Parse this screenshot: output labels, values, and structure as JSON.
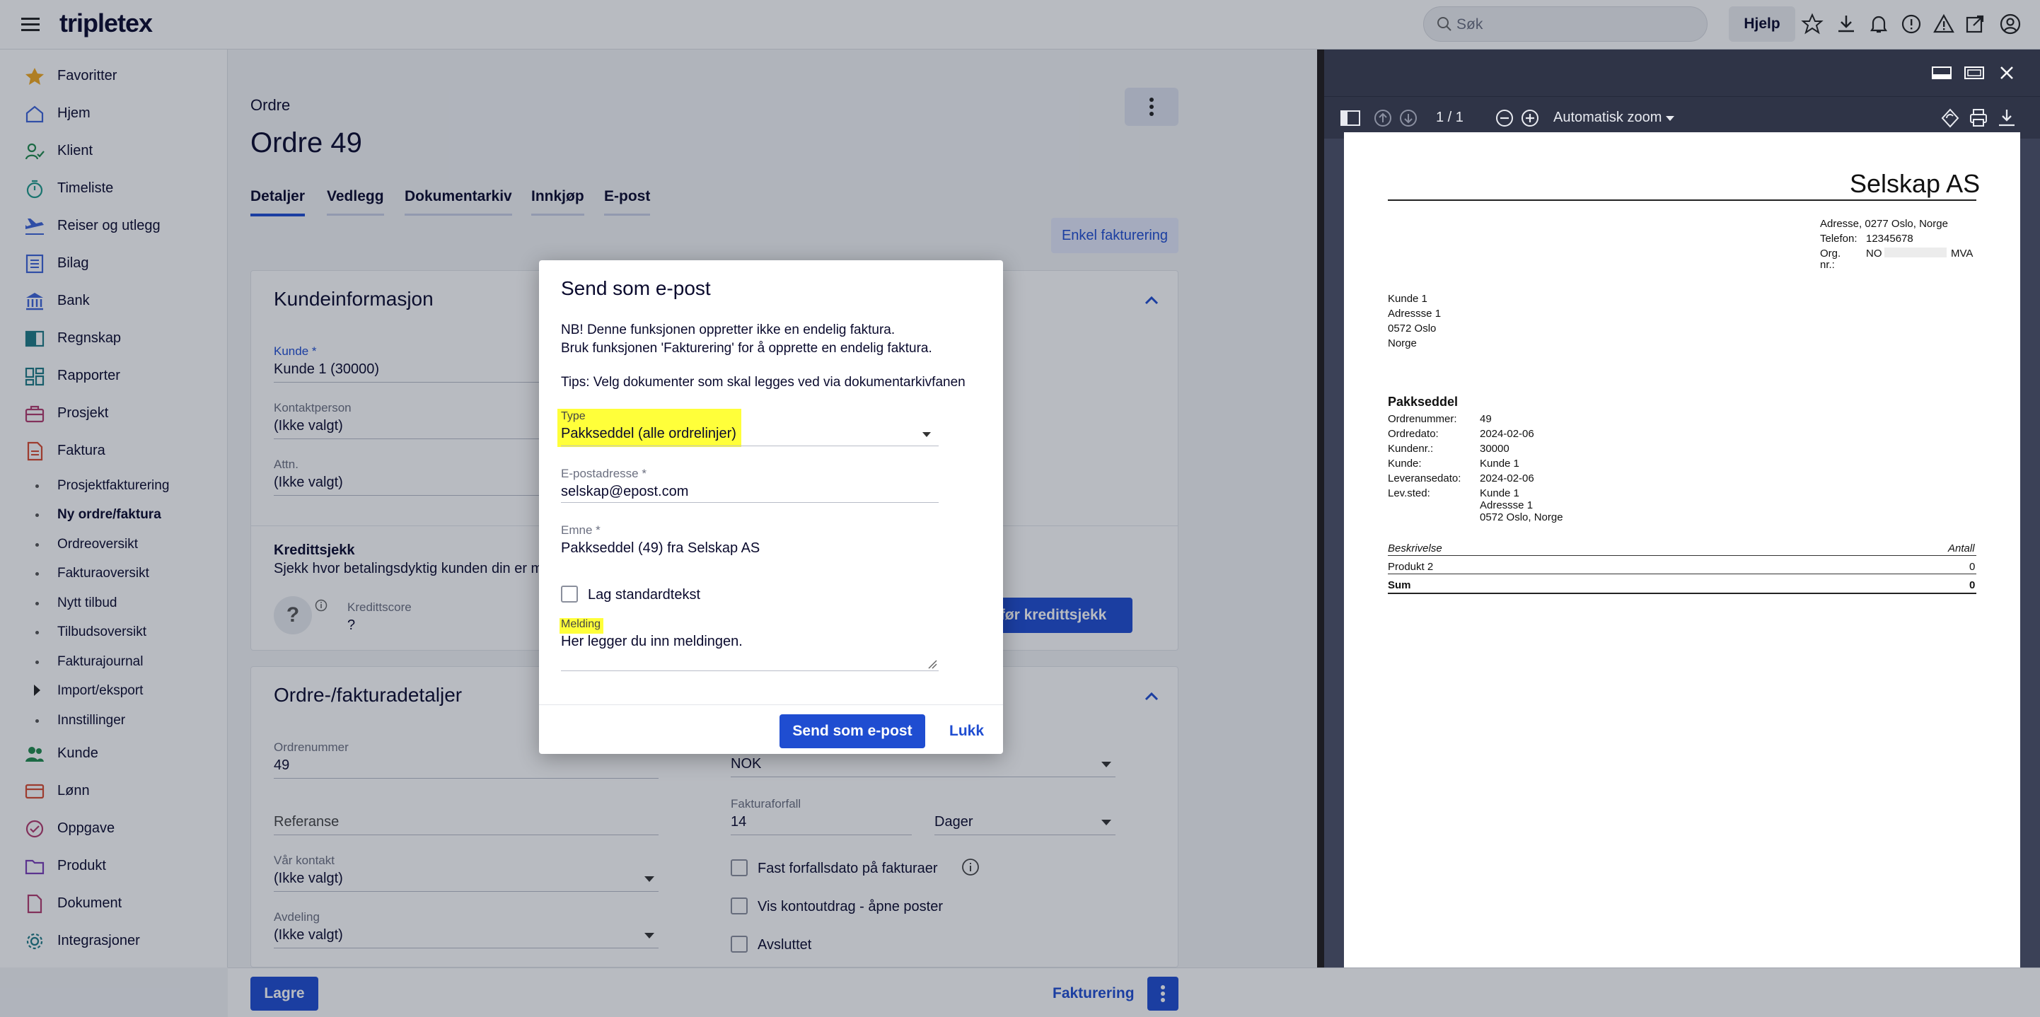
{
  "app": {
    "logo": "tripletex"
  },
  "topbar": {
    "search_placeholder": "Søk",
    "help_label": "Hjelp"
  },
  "sidebar": {
    "items": [
      {
        "label": "Favoritter",
        "icon": "star-icon"
      },
      {
        "label": "Hjem",
        "icon": "home-icon"
      },
      {
        "label": "Klient",
        "icon": "client-icon"
      },
      {
        "label": "Timeliste",
        "icon": "timer-icon"
      },
      {
        "label": "Reiser og utlegg",
        "icon": "plane-icon"
      },
      {
        "label": "Bilag",
        "icon": "document-list-icon"
      },
      {
        "label": "Bank",
        "icon": "bank-icon"
      },
      {
        "label": "Regnskap",
        "icon": "book-icon"
      },
      {
        "label": "Rapporter",
        "icon": "dashboard-icon"
      },
      {
        "label": "Prosjekt",
        "icon": "briefcase-icon"
      },
      {
        "label": "Faktura",
        "icon": "invoice-icon"
      }
    ],
    "subitems": [
      {
        "label": "Prosjektfakturering"
      },
      {
        "label": "Ny ordre/faktura",
        "active": true
      },
      {
        "label": "Ordreoversikt"
      },
      {
        "label": "Fakturaoversikt"
      },
      {
        "label": "Nytt tilbud"
      },
      {
        "label": "Tilbudsoversikt"
      },
      {
        "label": "Fakturajournal"
      },
      {
        "label": "Import/eksport",
        "expandable": true
      },
      {
        "label": "Innstillinger"
      }
    ],
    "items2": [
      {
        "label": "Kunde",
        "icon": "customer-icon"
      },
      {
        "label": "Lønn",
        "icon": "salary-icon"
      },
      {
        "label": "Oppgave",
        "icon": "task-icon"
      },
      {
        "label": "Produkt",
        "icon": "folder-icon"
      },
      {
        "label": "Dokument",
        "icon": "file-icon"
      },
      {
        "label": "Integrasjoner",
        "icon": "gear-icon"
      }
    ]
  },
  "main": {
    "breadcrumb": "Ordre",
    "title": "Ordre 49",
    "tabs": [
      "Detaljer",
      "Vedlegg",
      "Dokumentarkiv",
      "Innkjøp",
      "E-post"
    ],
    "enkel_button": "Enkel fakturering",
    "kunde_card": {
      "title": "Kundeinformasjon",
      "kunde_label": "Kunde *",
      "kunde_value": "Kunde 1 (30000)",
      "kontakt_label": "Kontaktperson",
      "kontakt_value": "(Ikke valgt)",
      "attn_label": "Attn.",
      "attn_value": "(Ikke valgt)",
      "kreditt_title": "Kredittsjekk",
      "kreditt_text": "Sjekk hvor betalingsdyktig kunden din er med",
      "score_label": "Kredittscore",
      "score_value": "?",
      "kreditt_button": "Utfør kredittsjekk"
    },
    "ordre_card": {
      "title": "Ordre-/fakturadetaljer",
      "ordrenr_label": "Ordrenummer",
      "ordrenr_value": "49",
      "currency_value": "NOK",
      "referanse_label": "Referanse",
      "forfall_label": "Fakturaforfall",
      "forfall_value": "14",
      "forfall_unit": "Dager",
      "kontakt_label": "Vår kontakt",
      "kontakt_value": "(Ikke valgt)",
      "avdeling_label": "Avdeling",
      "avdeling_value": "(Ikke valgt)",
      "check1": "Fast forfallsdato på fakturaer",
      "check2": "Vis kontoutdrag - åpne poster",
      "check3": "Avsluttet"
    }
  },
  "bottombar": {
    "save_label": "Lagre",
    "invoice_label": "Fakturering"
  },
  "viewer": {
    "page_indicator": "1 / 1",
    "zoom_label": "Automatisk zoom"
  },
  "document": {
    "company": "Selskap AS",
    "address": "Adresse, 0277 Oslo, Norge",
    "phone_label": "Telefon:",
    "phone": "12345678",
    "org_label1": "Org.",
    "org_label2": "nr.:",
    "org_prefix": "NO",
    "org_suffix": "MVA",
    "customer_lines": [
      "Kunde 1",
      "Adressse 1",
      "0572 Oslo",
      "Norge"
    ],
    "doc_title": "Pakkseddel",
    "meta": [
      {
        "k": "Ordrenummer:",
        "v": "49"
      },
      {
        "k": "Ordredato:",
        "v": "2024-02-06"
      },
      {
        "k": "Kundenr.:",
        "v": "30000"
      },
      {
        "k": "Kunde:",
        "v": "Kunde 1"
      },
      {
        "k": "Leveransedato:",
        "v": "2024-02-06"
      },
      {
        "k": "Lev.sted:",
        "v": "Kunde 1"
      }
    ],
    "levsted_extra": [
      "Adressse 1",
      "0572 Oslo, Norge"
    ],
    "table_head": [
      "Beskrivelse",
      "Antall"
    ],
    "rows": [
      {
        "desc": "Produkt 2",
        "qty": "0"
      }
    ],
    "sum_label": "Sum",
    "sum_value": "0"
  },
  "modal": {
    "title": "Send som e-post",
    "info1": "NB! Denne funksjonen oppretter ikke en endelig faktura.",
    "info2": "Bruk funksjonen 'Fakturering' for å opprette en endelig faktura.",
    "tips": "Tips: Velg dokumenter som skal legges ved via dokumentarkivfanen",
    "type_label": "Type",
    "type_value": "Pakkseddel (alle ordrelinjer)",
    "email_label": "E-postadresse *",
    "email_value": "selskap@epost.com",
    "subject_label": "Emne *",
    "subject_value": "Pakkseddel (49) fra Selskap AS",
    "standard_text_label": "Lag standardtekst",
    "message_label": "Melding",
    "message_value": "Her legger du inn meldingen.",
    "send_button": "Send som e-post",
    "close_button": "Lukk",
    "highlight_color": "#ffff3a"
  },
  "colors": {
    "accent": "#1f4dd1",
    "viewer_bg": "#3b4157",
    "highlight": "#ffff3a"
  }
}
